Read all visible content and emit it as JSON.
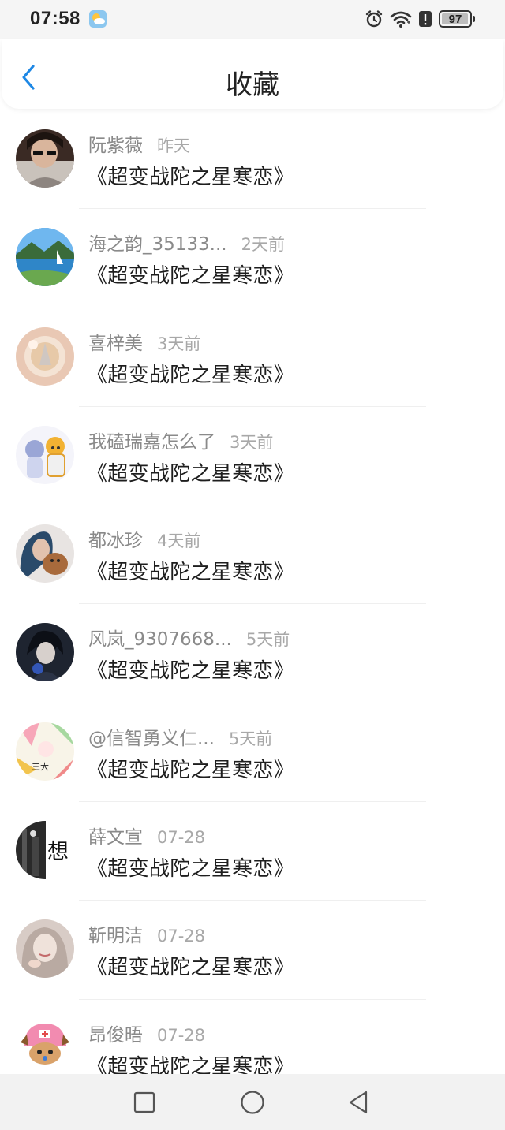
{
  "status_bar": {
    "time": "07:58",
    "battery": "97",
    "battery_level": 0.97
  },
  "header": {
    "title": "收藏"
  },
  "accent_color": "#1E88E5",
  "items": [
    {
      "user": "阮紫薇",
      "time": "昨天",
      "title": "《超变战陀之星寒恋》",
      "avatar": "dark-portrait"
    },
    {
      "user": "海之韵_35133...",
      "time": "2天前",
      "title": "《超变战陀之星寒恋》",
      "avatar": "lake-landscape"
    },
    {
      "user": "喜梓美",
      "time": "3天前",
      "title": "《超变战陀之星寒恋》",
      "avatar": "glass-drink"
    },
    {
      "user": "我磕瑞嘉怎么了",
      "time": "3天前",
      "title": "《超变战陀之星寒恋》",
      "avatar": "anime-duo"
    },
    {
      "user": "都冰珍",
      "time": "4天前",
      "title": "《超变战陀之星寒恋》",
      "avatar": "woman-with-dog"
    },
    {
      "user": "风岚_9307668...",
      "time": "5天前",
      "title": "《超变战陀之星寒恋》",
      "avatar": "dark-anime-boy"
    },
    {
      "user": "@信智勇义仁...",
      "time": "5天前",
      "title": "《超变战陀之星寒恋》",
      "avatar": "colorful-collage"
    },
    {
      "user": "薛文宣",
      "time": "07-28",
      "title": "《超变战陀之星寒恋》",
      "avatar": "bw-xiang"
    },
    {
      "user": "靳明洁",
      "time": "07-28",
      "title": "《超变战陀之星寒恋》",
      "avatar": "soft-portrait"
    },
    {
      "user": "昂俊晤",
      "time": "07-28",
      "title": "《超变战陀之星寒恋》",
      "avatar": "chopper-cartoon"
    }
  ],
  "avatar_badges": {
    "collage": "三大",
    "xiang": "想"
  },
  "nav": {
    "icons": [
      "recents-square-icon",
      "home-circle-icon",
      "back-triangle-icon"
    ]
  }
}
